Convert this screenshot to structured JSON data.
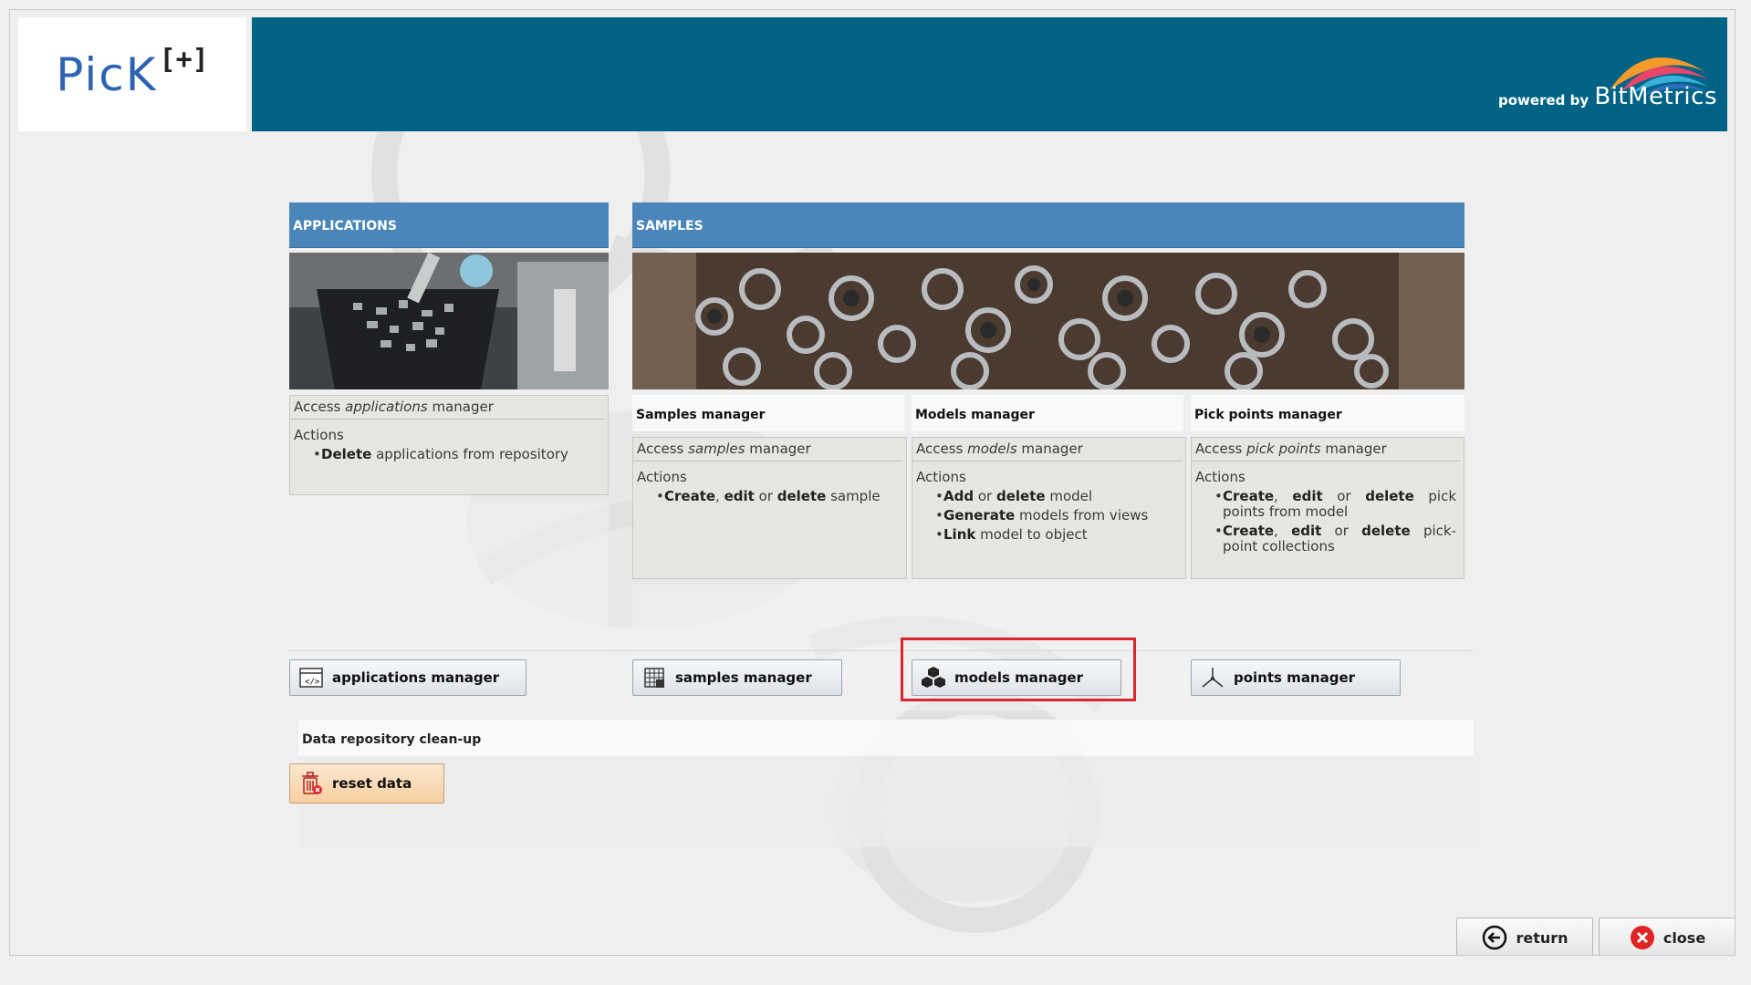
{
  "logo": {
    "text": "PicK",
    "plus": "[+]"
  },
  "banner": {
    "powered_by": "powered by",
    "brand": "BitMetrics"
  },
  "applications": {
    "header": "APPLICATIONS",
    "access_prefix": "Access ",
    "access_emph": "applications",
    "access_suffix": " manager",
    "actions_label": "Actions",
    "items": [
      {
        "bold": "Delete",
        "rest": " applications from repository"
      }
    ],
    "button_label": "applications manager"
  },
  "samples": {
    "header": "SAMPLES",
    "columns": [
      {
        "title": "Samples manager",
        "access_prefix": "Access ",
        "access_emph": "samples",
        "access_suffix": " manager",
        "actions_label": "Actions",
        "items": [
          {
            "b1": "Create",
            "t1": ", ",
            "b2": "edit",
            "t2": " or ",
            "b3": "delete",
            "t3": " sample"
          }
        ],
        "button_label": "samples manager"
      },
      {
        "title": "Models manager",
        "access_prefix": "Access ",
        "access_emph": "models",
        "access_suffix": " manager",
        "actions_label": "Actions",
        "items": [
          {
            "bold": "Add",
            "mid": " or ",
            "bold2": "delete",
            "rest": " model"
          },
          {
            "bold": "Generate",
            "rest": " models from views"
          },
          {
            "bold": "Link",
            "rest": " model to object"
          }
        ],
        "button_label": "models manager"
      },
      {
        "title": "Pick points manager",
        "access_prefix": "Access ",
        "access_emph": "pick points",
        "access_suffix": " manager",
        "actions_label": "Actions",
        "items": [
          {
            "b1": "Create",
            "t1": ", ",
            "b2": "edit",
            "t2": " or ",
            "b3": "delete",
            "t3": " pick points from model"
          },
          {
            "b1": "Create",
            "t1": ", ",
            "b2": "edit",
            "t2": " or ",
            "b3": "delete",
            "t3": " pick-point collections"
          }
        ],
        "button_label": "points manager"
      }
    ]
  },
  "cleanup": {
    "header": "Data repository clean-up",
    "button_label": "reset data"
  },
  "footer": {
    "return_label": "return",
    "close_label": "close"
  },
  "colors": {
    "banner": "#006285",
    "section_header": "#4a86ba",
    "highlight": "#d9262c",
    "logo": "#2d63b0"
  },
  "icons": [
    "code-window-icon",
    "grid-table-icon",
    "cubes-icon",
    "axes-icon",
    "trash-icon",
    "return-arrow-icon",
    "close-x-icon"
  ]
}
